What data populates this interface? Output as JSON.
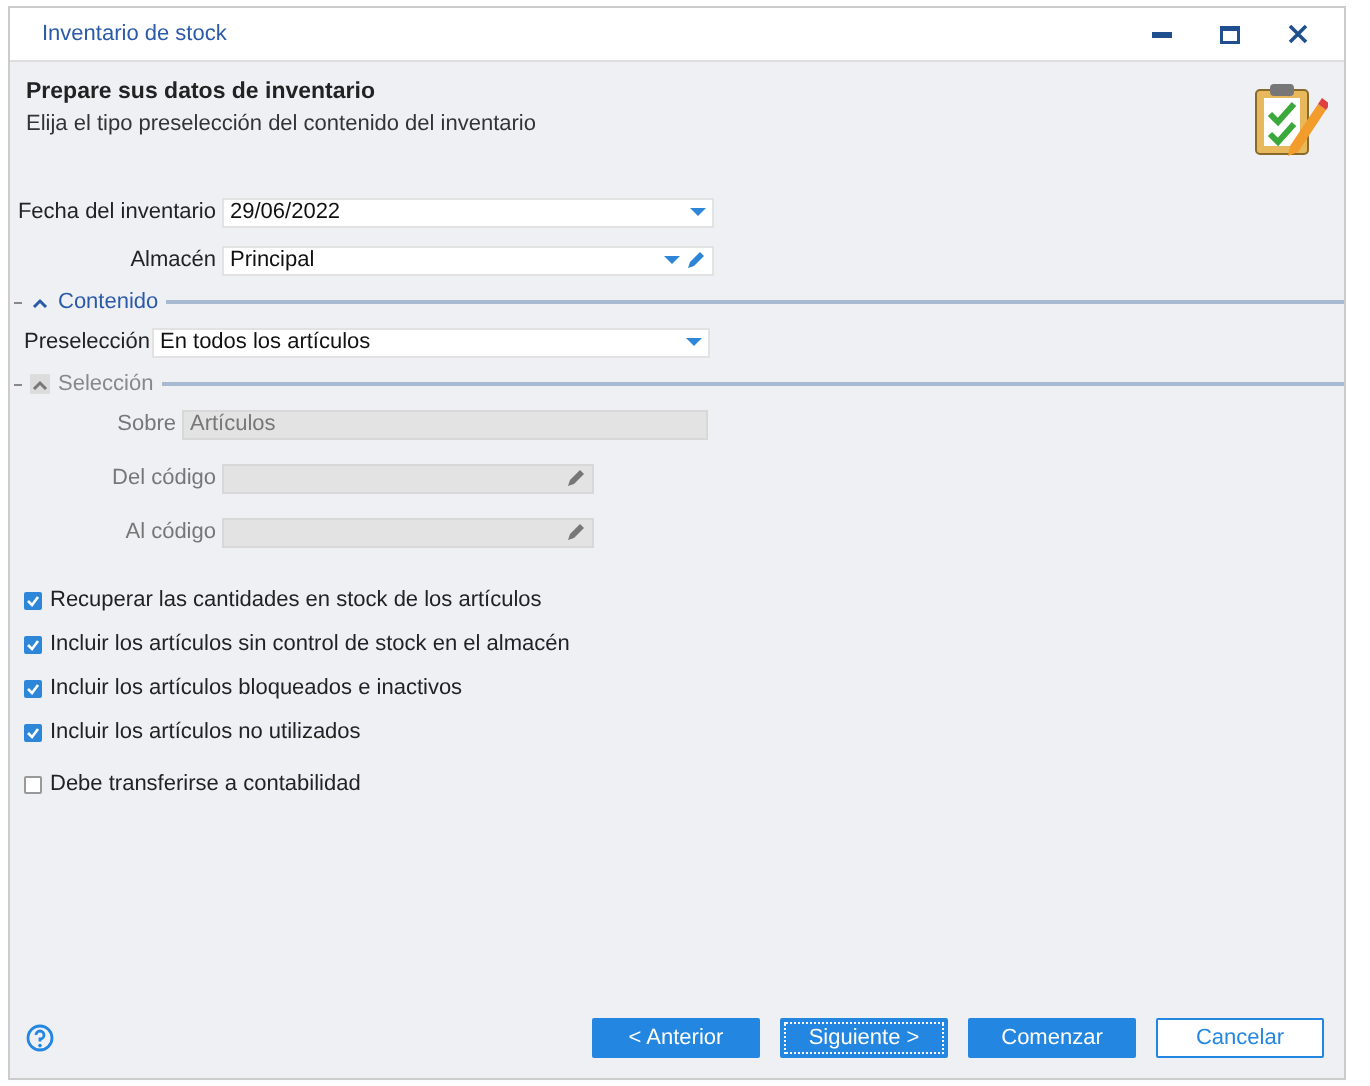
{
  "window": {
    "title": "Inventario de stock"
  },
  "header": {
    "title": "Prepare sus datos de inventario",
    "subtitle": "Elija el tipo preselección del contenido del inventario"
  },
  "fields": [
    {
      "label": "Fecha del inventario",
      "value": "29/06/2022",
      "kind": "dropdown",
      "disabled": false
    },
    {
      "label": "Almacén",
      "value": "Principal",
      "kind": "dropdown-edit",
      "disabled": false
    }
  ],
  "sections": [
    {
      "title": "Contenido",
      "expanded": true,
      "disabled": false,
      "fields": [
        {
          "label": "Preselección",
          "value": "En todos los artículos",
          "kind": "dropdown",
          "disabled": false
        }
      ]
    },
    {
      "title": "Selección",
      "expanded": true,
      "disabled": true,
      "fields": [
        {
          "label": "Sobre",
          "value": "Artículos",
          "kind": "text",
          "disabled": true
        },
        {
          "label": "Del código",
          "kind": "edit",
          "disabled": true
        },
        {
          "label": "Al código",
          "kind": "edit",
          "disabled": true
        }
      ]
    }
  ],
  "checkboxes": [
    {
      "label": "Recuperar las cantidades en stock de los artículos",
      "checked": true
    },
    {
      "label": "Incluir los artículos sin control de stock en el almacén",
      "checked": true
    },
    {
      "label": "Incluir los artículos bloqueados e inactivos",
      "checked": true
    },
    {
      "label": "Incluir los artículos no utilizados",
      "checked": true
    },
    {
      "label": "Debe transferirse a contabilidad",
      "checked": false
    }
  ],
  "buttons": [
    {
      "label": "< Anterior",
      "kind": "primary",
      "focused": false
    },
    {
      "label": "Siguiente >",
      "kind": "primary",
      "focused": true
    },
    {
      "label": "Comenzar",
      "kind": "primary",
      "focused": false
    },
    {
      "label": "Cancelar",
      "kind": "secondary",
      "focused": false
    }
  ]
}
